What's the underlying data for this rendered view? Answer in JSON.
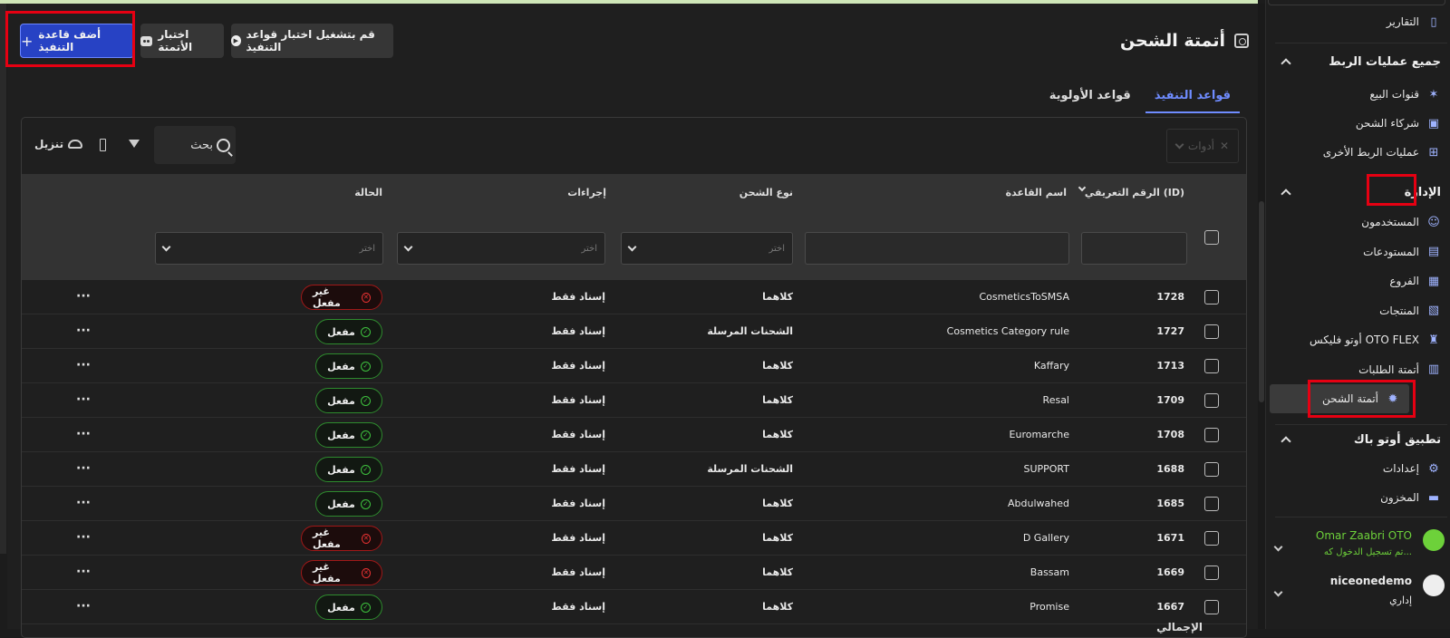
{
  "header": {
    "title": "أتمتة الشحن",
    "add_rule_label": "أضف قاعدة التنفيذ",
    "test_automation_label": "اختبار الأتمتة",
    "run_test_label": "قم بتشغيل اختبار قواعد التنفيذ"
  },
  "tabs": [
    {
      "label": "قواعد التنفيذ",
      "active": true
    },
    {
      "label": "قواعد الأولوية",
      "active": false
    }
  ],
  "toolbar": {
    "tools_label": "أدوات",
    "search_placeholder": "بحث",
    "download_label": "تنزيل"
  },
  "table": {
    "columns": {
      "id": "الرقم التعريفي (ID)",
      "name": "اسم القاعدة",
      "shipping_type": "نوع الشحن",
      "actions": "إجراءات",
      "status": "الحالة"
    },
    "filter_placeholder": "اختر",
    "rows": [
      {
        "id": "1728",
        "name": "CosmeticsToSMSA",
        "shipping_type": "كلاهما",
        "action": "إسناد فقط",
        "status": "غير مفعل",
        "active": false
      },
      {
        "id": "1727",
        "name": "Cosmetics Category rule",
        "shipping_type": "الشحنات المرسلة",
        "action": "إسناد فقط",
        "status": "مفعل",
        "active": true
      },
      {
        "id": "1713",
        "name": "Kaffary",
        "shipping_type": "كلاهما",
        "action": "إسناد فقط",
        "status": "مفعل",
        "active": true
      },
      {
        "id": "1709",
        "name": "Resal",
        "shipping_type": "كلاهما",
        "action": "إسناد فقط",
        "status": "مفعل",
        "active": true
      },
      {
        "id": "1708",
        "name": "Euromarche",
        "shipping_type": "كلاهما",
        "action": "إسناد فقط",
        "status": "مفعل",
        "active": true
      },
      {
        "id": "1688",
        "name": "SUPPORT",
        "shipping_type": "الشحنات المرسلة",
        "action": "إسناد فقط",
        "status": "مفعل",
        "active": true
      },
      {
        "id": "1685",
        "name": "Abdulwahed",
        "shipping_type": "كلاهما",
        "action": "إسناد فقط",
        "status": "مفعل",
        "active": true
      },
      {
        "id": "1671",
        "name": "D Gallery",
        "shipping_type": "كلاهما",
        "action": "إسناد فقط",
        "status": "غير مفعل",
        "active": false
      },
      {
        "id": "1669",
        "name": "Bassam",
        "shipping_type": "كلاهما",
        "action": "إسناد فقط",
        "status": "غير مفعل",
        "active": false
      },
      {
        "id": "1667",
        "name": "Promise",
        "shipping_type": "كلاهما",
        "action": "إسناد فقط",
        "status": "مفعل",
        "active": true
      }
    ],
    "more_label": "···",
    "footer_label": "الإجمالي"
  },
  "sidebar": {
    "reports": "التقارير",
    "integrations_section": "جميع عمليات الربط",
    "integrations": [
      {
        "label": "قنوات البيع",
        "icon": "sales-channels-icon"
      },
      {
        "label": "شركاء الشحن",
        "icon": "truck-icon"
      },
      {
        "label": "عمليات الربط الأخرى",
        "icon": "grid-plus-icon"
      }
    ],
    "admin_section": "الإدارة",
    "admin": [
      {
        "label": "المستخدمون",
        "icon": "users-icon"
      },
      {
        "label": "المستودعات",
        "icon": "warehouse-icon"
      },
      {
        "label": "الفروع",
        "icon": "store-icon"
      },
      {
        "label": "المنتجات",
        "icon": "box-icon"
      },
      {
        "label": "أوتو فليكس OTO FLEX",
        "icon": "courier-icon"
      },
      {
        "label": "أتمتة الطلبات",
        "icon": "order-automation-icon"
      },
      {
        "label": "أتمتة الشحن",
        "icon": "shipping-automation-icon",
        "active": true
      }
    ],
    "app_section": "تطبيق أوتو باك",
    "app": [
      {
        "label": "إعدادات",
        "icon": "settings-icon"
      },
      {
        "label": "المخزون",
        "icon": "inventory-icon"
      }
    ],
    "support_user": {
      "name": "Omar Zaabri OTO",
      "status": "تم تسجيل الدخول كه..."
    },
    "account": {
      "name": "niceonedemo",
      "role": "إداري"
    }
  },
  "colors": {
    "primary": "#2742c4",
    "tab_active": "#6f8cff",
    "active_green": "#3ec23e",
    "inactive_red": "#e33333",
    "highlight_red": "#e60012",
    "support_green": "#6dd13a"
  }
}
